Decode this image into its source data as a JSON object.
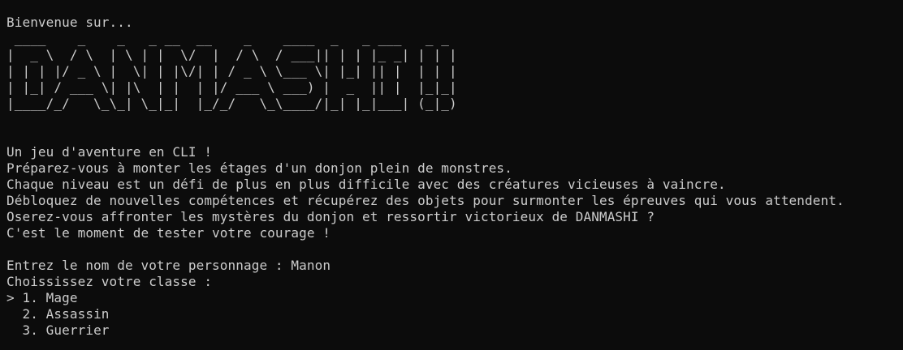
{
  "welcome": "Bienvenue sur...",
  "ascii_logo": [
    " ____    _    _   _ __  __    _    ____  _   _ ___   _ _ ",
    "|  _ \\  / \\  | \\ | |  \\/  |  / \\  / ___|| | | |_ _| | | |",
    "| | | |/ _ \\ |  \\| | |\\/| | / _ \\ \\___ \\| |_| || |  | | |",
    "| |_| / ___ \\| |\\  | |  | |/ ___ \\ ___) |  _  || |  |_|_|",
    "|____/_/   \\_\\_| \\_|_|  |_/_/   \\_\\____/|_| |_|___| (_|_)"
  ],
  "intro": [
    "Un jeu d'aventure en CLI !",
    "Préparez-vous à monter les étages d'un donjon plein de monstres.",
    "Chaque niveau est un défi de plus en plus difficile avec des créatures vicieuses à vaincre.",
    "Débloquez de nouvelles compétences et récupérez des objets pour surmonter les épreuves qui vous attendent.",
    "Oserez-vous affronter les mystères du donjon et ressortir victorieux de DANMASHI ?",
    "C'est le moment de tester votre courage !"
  ],
  "name_prompt": {
    "label": "Entrez le nom de votre personnage : ",
    "value": "Manon"
  },
  "class_prompt": "Choississez votre classe :",
  "class_options": [
    {
      "marker": "> ",
      "label": "1. Mage"
    },
    {
      "marker": "  ",
      "label": "2. Assassin"
    },
    {
      "marker": "  ",
      "label": "3. Guerrier"
    }
  ],
  "colors": {
    "background": "#0c0c0c",
    "foreground": "#cccccc"
  }
}
